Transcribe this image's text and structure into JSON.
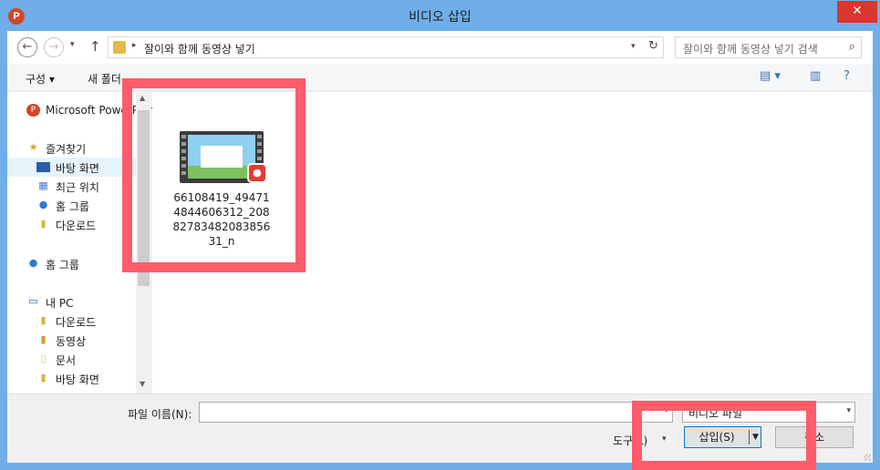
{
  "window": {
    "title": "비디오 삽입",
    "app_icon": "P",
    "close_glyph": "✕"
  },
  "nav": {
    "back_glyph": "←",
    "forward_glyph": "→",
    "recent_glyph": "▾",
    "up_glyph": "↑"
  },
  "address": {
    "separator": "▸",
    "path": "잘이와 함께 동영상 넣기",
    "dropdown_glyph": "▾",
    "refresh_glyph": "↻"
  },
  "search": {
    "placeholder": "잘이와 함께 동영상 넣기 검색",
    "icon_glyph": "⌕"
  },
  "commandbar": {
    "organize_label": "구성 ▾",
    "new_folder_label": "새 폴더",
    "view_glyph": "▤ ▾",
    "pane_glyph": "▥",
    "help_glyph": "?"
  },
  "sidebar": {
    "items": [
      {
        "label": "Microsoft PowerPoint",
        "icon": "powerpoint-icon"
      },
      {
        "label": "즐겨찾기",
        "icon": "star-icon"
      },
      {
        "label": "바탕 화면",
        "icon": "desktop-icon"
      },
      {
        "label": "최근 위치",
        "icon": "recent-places-icon"
      },
      {
        "label": "홈 그룹",
        "icon": "homegroup-icon"
      },
      {
        "label": "다운로드",
        "icon": "downloads-icon"
      },
      {
        "label": "홈 그룹",
        "icon": "homegroup-icon"
      },
      {
        "label": "내 PC",
        "icon": "pc-icon"
      },
      {
        "label": "다운로드",
        "icon": "downloads-icon"
      },
      {
        "label": "동영상",
        "icon": "videos-icon"
      },
      {
        "label": "문서",
        "icon": "documents-icon"
      },
      {
        "label": "바탕 화면",
        "icon": "desktop-icon"
      }
    ],
    "scroll_up_glyph": "▲",
    "scroll_down_glyph": "▼"
  },
  "files": [
    {
      "name": "66108419_494714844606312_2088278348208385631_n",
      "badge_glyph": "●"
    }
  ],
  "bottom": {
    "filename_label": "파일 이름(N):",
    "filename_value": "",
    "dropdown_glyph": "▾",
    "filetype_value": "비디오 파일",
    "tools_label": "도구(L)",
    "insert_label": "삽입(S)",
    "cancel_label": "취소"
  },
  "colors": {
    "titlebar": "#6faee8",
    "close": "#d9362e",
    "highlight": "#ff5c6b",
    "selection": "#e5f3fb"
  }
}
